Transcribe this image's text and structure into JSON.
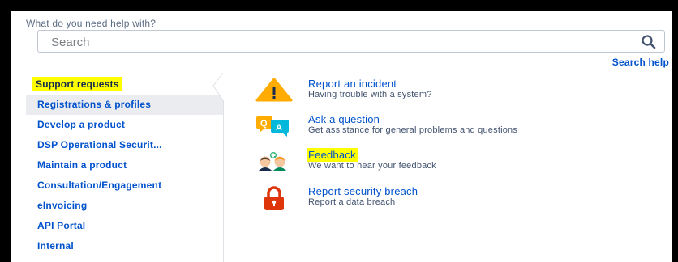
{
  "help_prompt": "What do you need help with?",
  "search": {
    "placeholder": "Search",
    "value": "",
    "help_link": "Search help"
  },
  "sidebar": {
    "items": [
      {
        "label": "Support requests"
      },
      {
        "label": "Registrations & profiles"
      },
      {
        "label": "Develop a product"
      },
      {
        "label": "DSP Operational Securit..."
      },
      {
        "label": "Maintain a product"
      },
      {
        "label": "Consultation/Engagement"
      },
      {
        "label": "eInvoicing"
      },
      {
        "label": "API Portal"
      },
      {
        "label": "Internal"
      }
    ]
  },
  "requests": [
    {
      "icon": "warning-icon",
      "title": "Report an incident",
      "description": "Having trouble with a system?"
    },
    {
      "icon": "qa-icon",
      "title": "Ask a question",
      "description": "Get assistance for general problems and questions"
    },
    {
      "icon": "feedback-people-icon",
      "title": "Feedback",
      "description": "We want to hear your feedback"
    },
    {
      "icon": "lock-icon",
      "title": "Report security breach",
      "description": "Report a data breach"
    }
  ],
  "colors": {
    "link": "#0052cc",
    "highlight": "#ffff00",
    "warning": "#ffab00",
    "qa": "#00b8d9",
    "lock": "#de350b"
  }
}
